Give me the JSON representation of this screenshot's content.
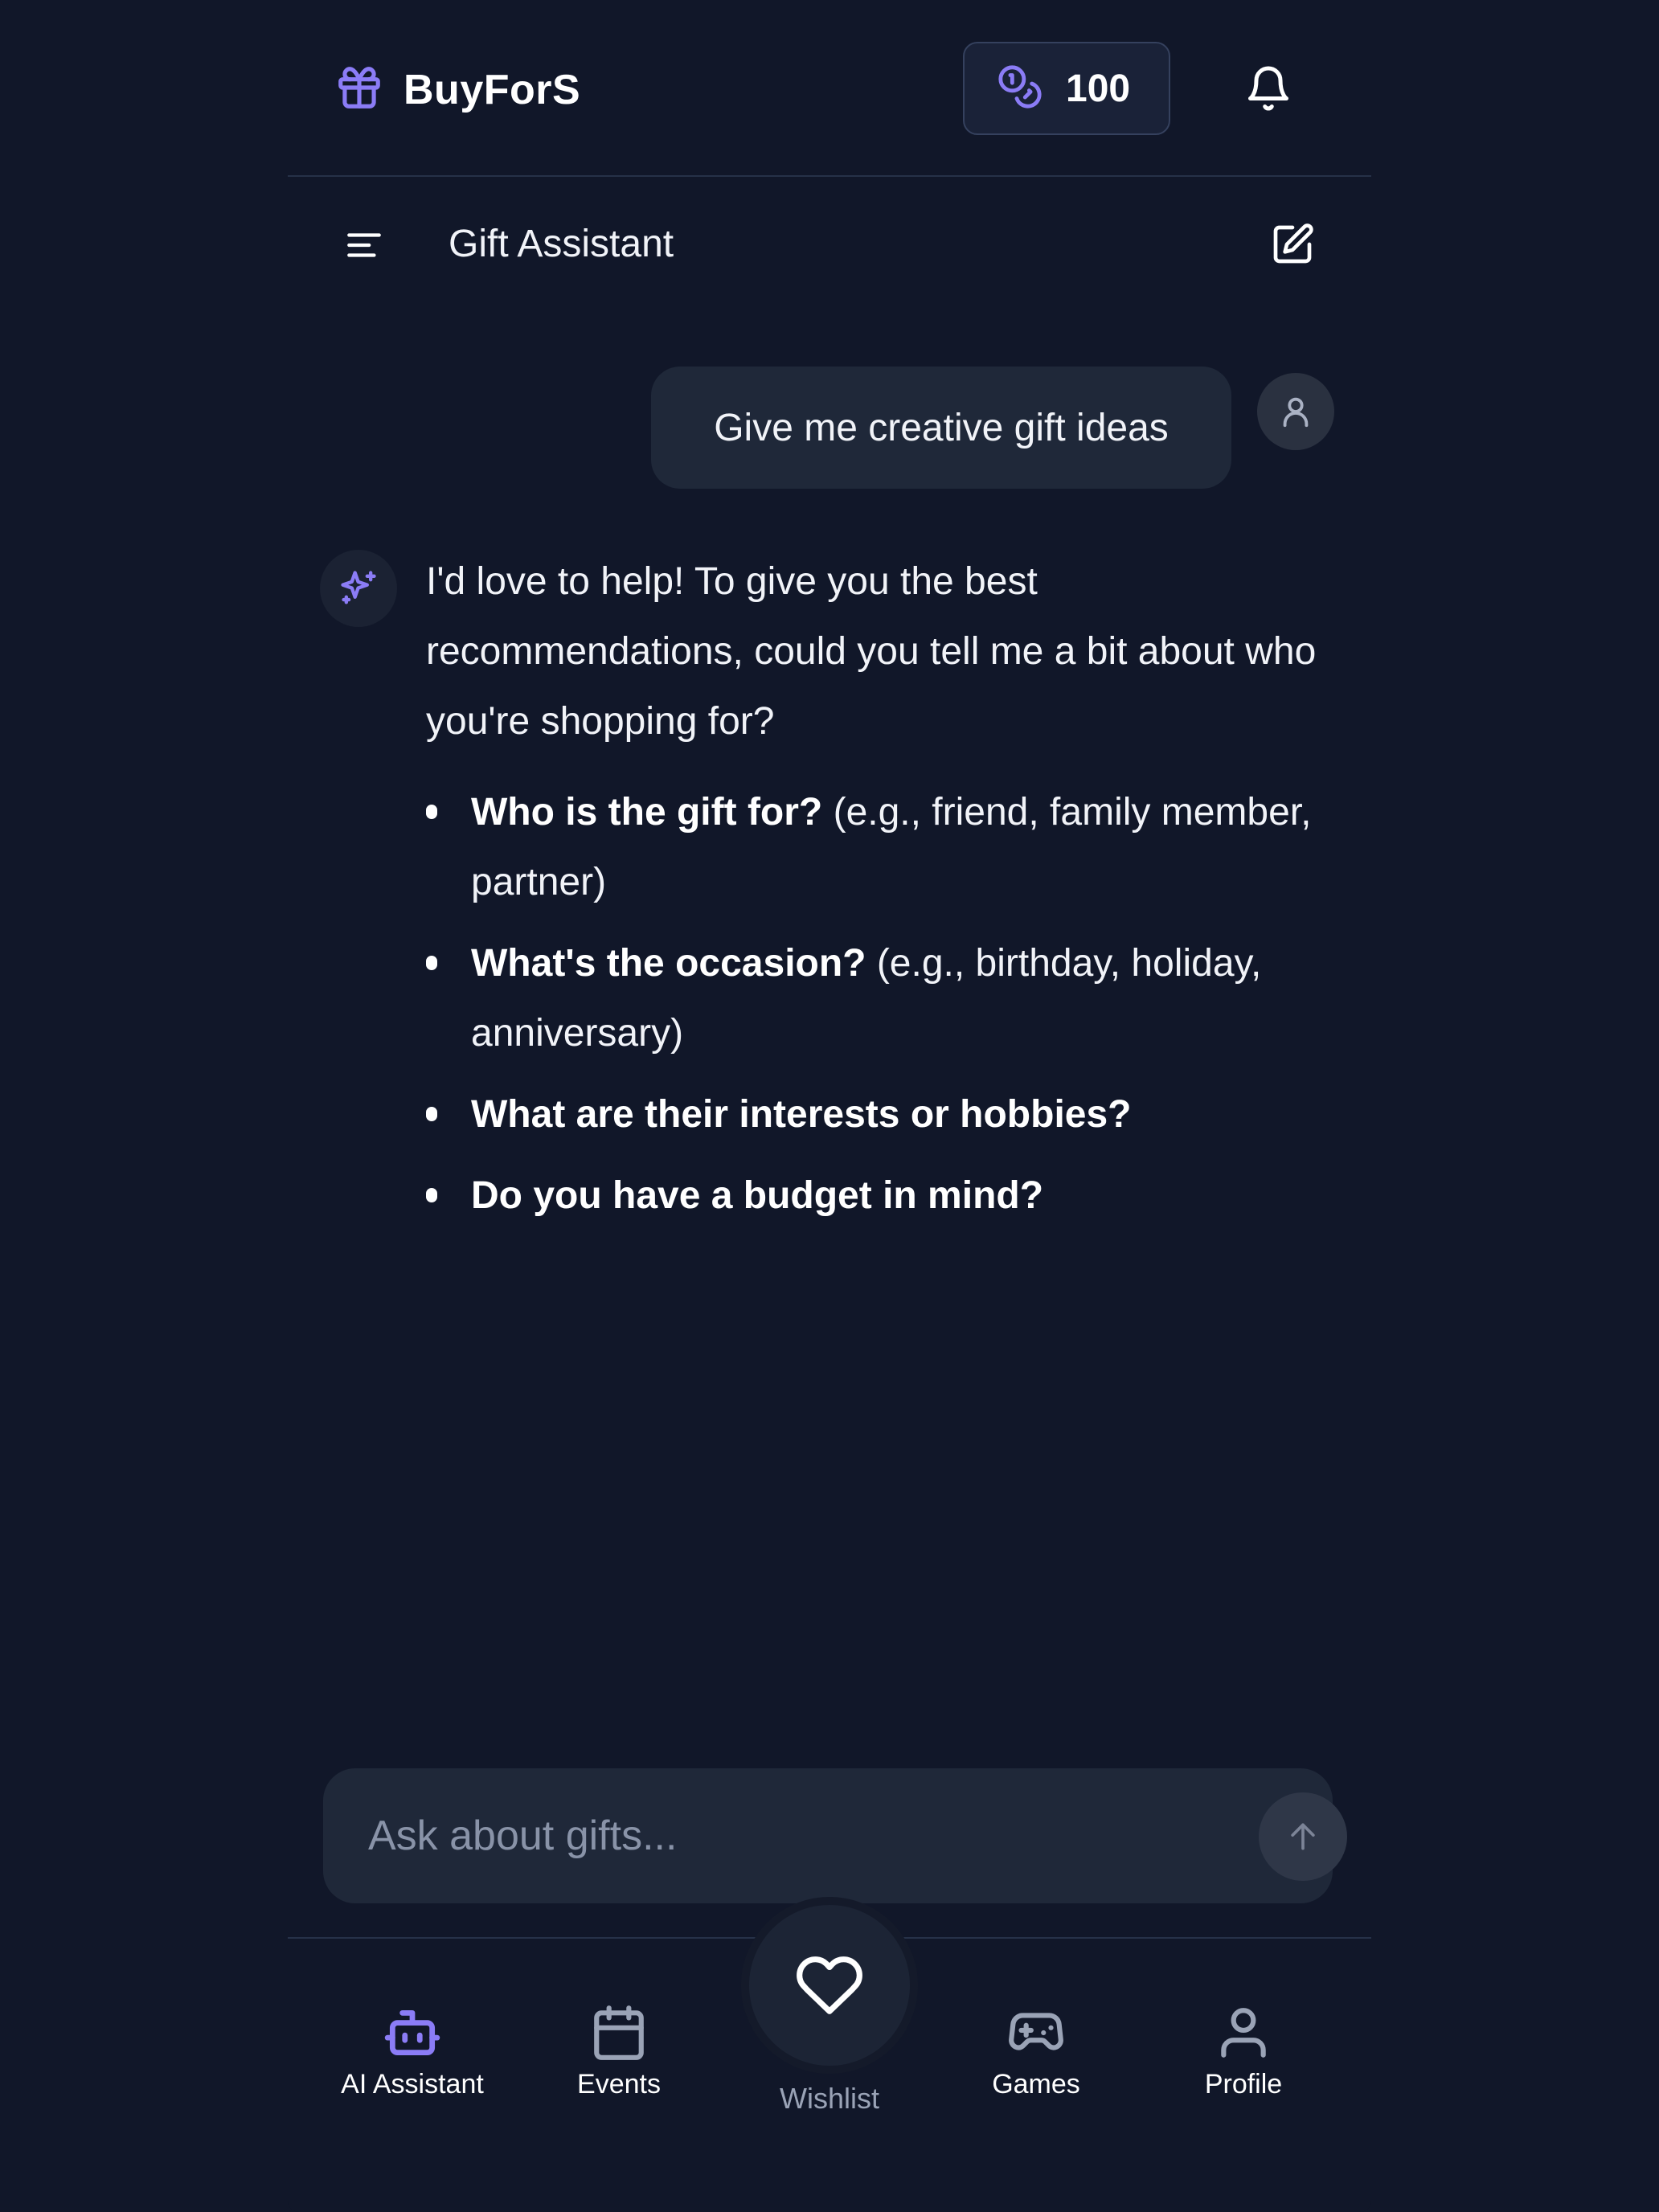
{
  "header": {
    "app_name": "BuyForS",
    "coins": "100"
  },
  "subheader": {
    "title": "Gift Assistant"
  },
  "chat": {
    "user_message": "Give me creative gift ideas",
    "bot_intro": "I'd love to help! To give you the best recommendations, could you tell me a bit about who you're shopping for?",
    "bot_items": [
      {
        "bold": "Who is the gift for?",
        "rest": " (e.g., friend, family member, partner)"
      },
      {
        "bold": "What's the occasion?",
        "rest": " (e.g., birthday, holiday, anniversary)"
      },
      {
        "bold": "What are their interests or hobbies?",
        "rest": ""
      },
      {
        "bold": "Do you have a budget in mind?",
        "rest": ""
      }
    ]
  },
  "input": {
    "placeholder": "Ask about gifts..."
  },
  "nav": {
    "ai_assistant": "AI Assistant",
    "events": "Events",
    "wishlist": "Wishlist",
    "games": "Games",
    "profile": "Profile"
  },
  "colors": {
    "background": "#111729",
    "accent": "#8b7cf6",
    "bubble": "#1f2839"
  },
  "icons": {
    "brand": "gift-icon",
    "coins": "coins-icon",
    "notifications": "bell-icon",
    "menu": "menu-icon",
    "new_chat": "edit-icon",
    "user": "user-icon",
    "assistant": "sparkles-icon",
    "send": "arrow-up-icon",
    "nav": [
      "robot-icon",
      "calendar-icon",
      "heart-icon",
      "gamepad-icon",
      "user-icon"
    ]
  }
}
